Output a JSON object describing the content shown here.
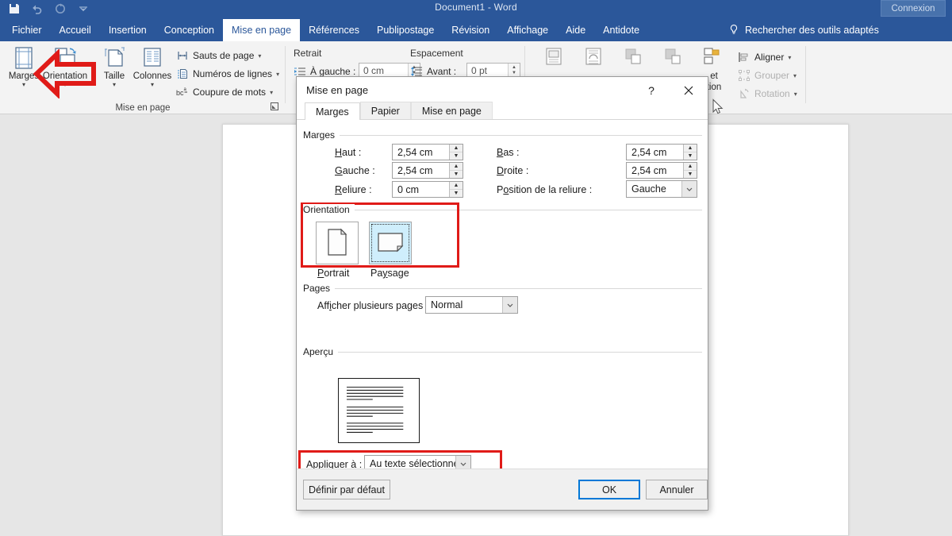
{
  "window": {
    "title": "Document1  -  Word",
    "signin_label": "Connexion",
    "quick_access": [
      "save-icon",
      "undo-icon",
      "redo-icon",
      "customize-qat-icon"
    ]
  },
  "ribbon": {
    "tabs": [
      {
        "label": "Fichier",
        "active": false
      },
      {
        "label": "Accueil",
        "active": false
      },
      {
        "label": "Insertion",
        "active": false
      },
      {
        "label": "Conception",
        "active": false
      },
      {
        "label": "Mise en page",
        "active": true
      },
      {
        "label": "Références",
        "active": false
      },
      {
        "label": "Publipostage",
        "active": false
      },
      {
        "label": "Révision",
        "active": false
      },
      {
        "label": "Affichage",
        "active": false
      },
      {
        "label": "Aide",
        "active": false
      },
      {
        "label": "Antidote",
        "active": false
      }
    ],
    "tell_me": {
      "icon": "lightbulb-icon",
      "label": "Rechercher des outils adaptés"
    },
    "group_mise_en_page": {
      "title": "Mise en page",
      "big_buttons": [
        {
          "label": "Marges",
          "icon": "margins-icon",
          "has_caret": true
        },
        {
          "label": "Orientation",
          "icon": "orientation-icon",
          "has_caret": true
        },
        {
          "label": "Taille",
          "icon": "size-icon",
          "has_caret": true
        },
        {
          "label": "Colonnes",
          "icon": "columns-icon",
          "has_caret": true
        }
      ],
      "small_buttons": [
        {
          "label": "Sauts de page",
          "icon": "page-breaks-icon",
          "caret": "▾"
        },
        {
          "label": "Numéros de lignes",
          "icon": "line-numbers-icon",
          "caret": "▾"
        },
        {
          "label": "Coupure de mots",
          "icon": "hyphenation-icon",
          "caret": "▾"
        }
      ]
    },
    "group_paragraphe": {
      "retrait_title": "Retrait",
      "espacement_title": "Espacement",
      "fields": [
        {
          "label": "À gauche :",
          "value": "0 cm",
          "icon": "indent-left-icon"
        },
        {
          "label": "Avant :",
          "value": "0 pt",
          "icon": "spacing-before-icon"
        }
      ]
    },
    "group_organiser": {
      "partial_labels": [
        "et",
        "tion"
      ],
      "buttons": [
        {
          "label": "Aligner",
          "icon": "align-objects-icon",
          "caret": "▾",
          "disabled": false
        },
        {
          "label": "Grouper",
          "icon": "group-objects-icon",
          "caret": "▾",
          "disabled": true
        },
        {
          "label": "Rotation",
          "icon": "rotate-objects-icon",
          "caret": "▾",
          "disabled": true
        }
      ]
    }
  },
  "dialog": {
    "title": "Mise en page",
    "help_glyph": "?",
    "tabs": [
      {
        "label": "Marges",
        "active": true
      },
      {
        "label": "Papier",
        "active": false
      },
      {
        "label": "Mise en page",
        "active": false
      }
    ],
    "marges": {
      "caption": "Marges",
      "fields": [
        {
          "label": "Haut :",
          "underline": "H",
          "value": "2,54 cm"
        },
        {
          "label": "Bas :",
          "underline": "B",
          "value": "2,54 cm"
        },
        {
          "label": "Gauche :",
          "underline": "G",
          "value": "2,54 cm"
        },
        {
          "label": "Droite :",
          "underline": "D",
          "value": "2,54 cm"
        },
        {
          "label": "Reliure :",
          "underline": "R",
          "value": "0 cm"
        }
      ],
      "gutter_position": {
        "label": "Position de la reliure :",
        "value": "Gauche"
      }
    },
    "orientation": {
      "caption": "Orientation",
      "options": [
        {
          "label": "Portrait",
          "selected": false,
          "icon": "portrait-page-icon"
        },
        {
          "label": "Paysage",
          "selected": true,
          "icon": "landscape-page-icon"
        }
      ],
      "highlighted": true
    },
    "pages": {
      "caption": "Pages",
      "multiple_pages": {
        "label": "Afficher plusieurs pages :",
        "value": "Normal"
      }
    },
    "apercu": {
      "caption": "Aperçu",
      "orientation_shown": "landscape"
    },
    "apply_to": {
      "label": "Appliquer à :",
      "value": "Au texte sélectionné",
      "highlighted": true
    },
    "buttons": [
      {
        "label": "Définir par défaut",
        "primary": false
      },
      {
        "label": "OK",
        "primary": true
      },
      {
        "label": "Annuler",
        "primary": false
      }
    ]
  },
  "annotations": {
    "highlight_color": "#e01b18",
    "arrow": {
      "name": "red-left-arrow",
      "direction": "left",
      "points_at": "Orientation"
    }
  },
  "colors": {
    "word_blue": "#2b579a",
    "accent_focus": "#0078d7",
    "highlight_red": "#e01b18",
    "selection_blue": "#cfeefc"
  }
}
